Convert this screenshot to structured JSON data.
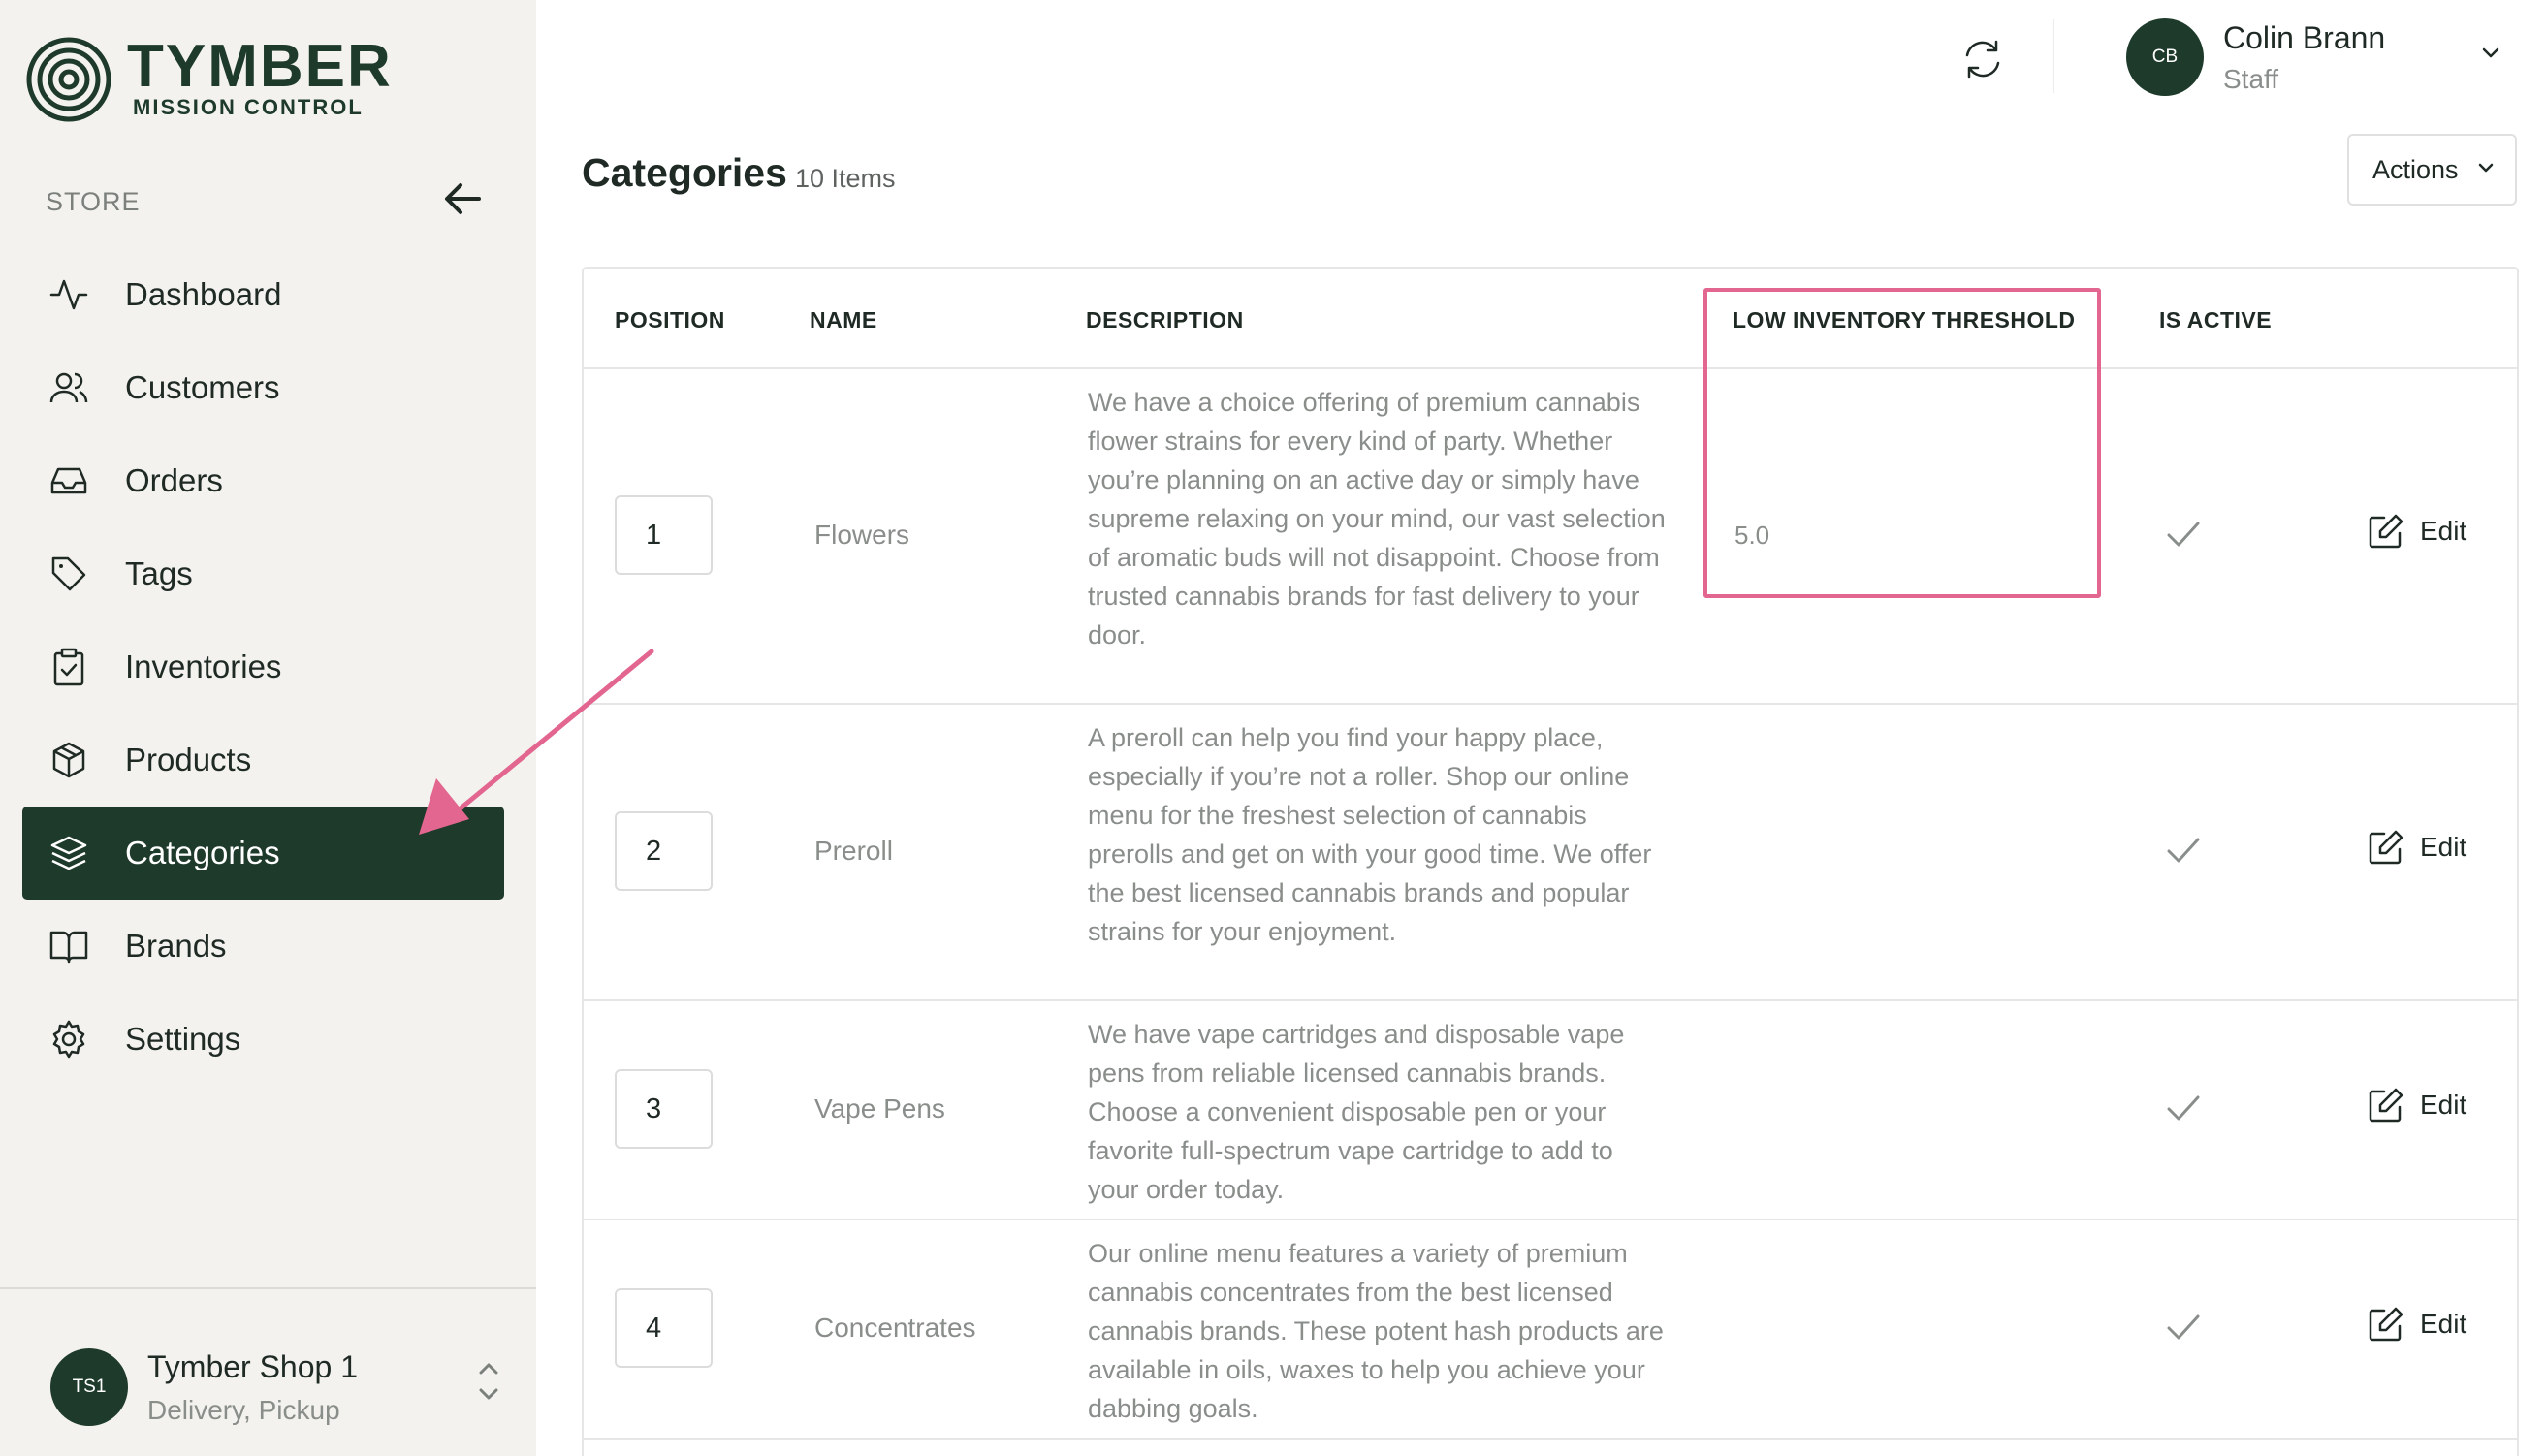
{
  "brand": {
    "name": "TYMBER",
    "subtitle": "MISSION CONTROL",
    "icon": "target-logo-icon"
  },
  "sidebar": {
    "section_label": "STORE",
    "items": [
      {
        "label": "Dashboard",
        "icon": "activity-icon",
        "active": false
      },
      {
        "label": "Customers",
        "icon": "users-icon",
        "active": false
      },
      {
        "label": "Orders",
        "icon": "inbox-icon",
        "active": false
      },
      {
        "label": "Tags",
        "icon": "tag-icon",
        "active": false
      },
      {
        "label": "Inventories",
        "icon": "clipboard-check-icon",
        "active": false
      },
      {
        "label": "Products",
        "icon": "box-icon",
        "active": false
      },
      {
        "label": "Categories",
        "icon": "layers-icon",
        "active": true
      },
      {
        "label": "Brands",
        "icon": "book-open-icon",
        "active": false
      },
      {
        "label": "Settings",
        "icon": "gear-icon",
        "active": false
      }
    ],
    "store": {
      "initials": "TS1",
      "name": "Tymber Shop 1",
      "modes": "Delivery, Pickup"
    }
  },
  "header": {
    "user": {
      "initials": "CB",
      "name": "Colin Brann",
      "role": "Staff"
    }
  },
  "page": {
    "title": "Categories",
    "count": "10 Items",
    "actions_label": "Actions"
  },
  "table": {
    "columns": [
      "POSITION",
      "NAME",
      "DESCRIPTION",
      "LOW INVENTORY THRESHOLD",
      "IS ACTIVE"
    ],
    "edit_label": "Edit",
    "rows": [
      {
        "position": "1",
        "name": "Flowers",
        "description": "We have a choice offering of premium cannabis flower strains for every kind of party. Whether you’re planning on an active day or simply have supreme relaxing on your mind, our vast selection of aromatic buds will not disappoint. Choose from trusted cannabis brands for fast delivery to your door.",
        "threshold": "5.0",
        "active": true
      },
      {
        "position": "2",
        "name": "Preroll",
        "description": "A preroll can help you find your happy place, especially if you’re not a roller. Shop our online menu for the freshest selection of cannabis prerolls and get on with your good time. We offer the best licensed cannabis brands and popular strains for your enjoyment.",
        "threshold": "",
        "active": true
      },
      {
        "position": "3",
        "name": "Vape Pens",
        "description": "We have vape cartridges and disposable vape pens from reliable licensed cannabis brands. Choose a convenient disposable pen or your favorite full-spectrum vape cartridge to add to your order today.",
        "threshold": "",
        "active": true
      },
      {
        "position": "4",
        "name": "Concentrates",
        "description": "Our online menu features a variety of premium cannabis concentrates from the best licensed cannabis brands. These potent hash products are available in oils, waxes to help you achieve your dabbing goals.",
        "threshold": "",
        "active": true
      }
    ]
  },
  "colors": {
    "brand_green": "#1e3a2b",
    "annotation_pink": "#e2668f",
    "sidebar_bg": "#f3f2ee"
  }
}
